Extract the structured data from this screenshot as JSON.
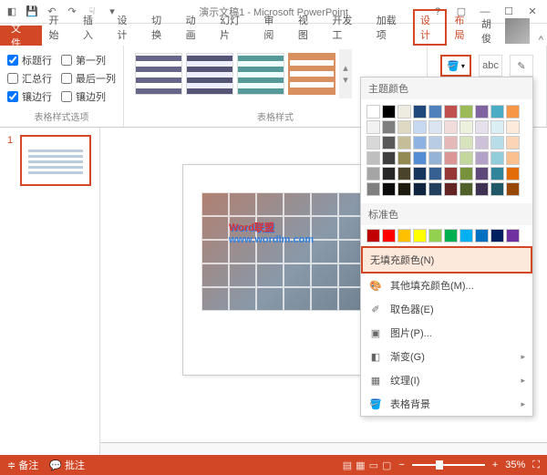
{
  "title": "演示文稿1 - Microsoft PowerPoint",
  "tabs": {
    "file": "文件",
    "home": "开始",
    "insert": "插入",
    "design": "设计",
    "transition": "切换",
    "animation": "动画",
    "slideshow": "幻灯片",
    "review": "审阅",
    "view": "视图",
    "developer": "开发工",
    "addins": "加载项",
    "tdesign": "设计",
    "layout": "布局"
  },
  "username": "胡俊",
  "checks": {
    "header_row": "标题行",
    "first_col": "第一列",
    "total_row": "汇总行",
    "last_col": "最后一列",
    "banded_row": "镶边行",
    "banded_col": "镶边列"
  },
  "group_labels": {
    "options": "表格样式选项",
    "styles": "表格样式"
  },
  "dropdown": {
    "theme_colors": "主题颜色",
    "standard_colors": "标准色",
    "no_fill": "无填充颜色(N)",
    "more_colors": "其他填充颜色(M)...",
    "eyedropper": "取色器(E)",
    "picture": "图片(P)...",
    "gradient": "渐变(G)",
    "texture": "纹理(I)",
    "table_bg": "表格背景"
  },
  "watermark": {
    "line1": "Word联盟",
    "line2": "www.wordlm.com"
  },
  "status": {
    "ready": "备注",
    "comments": "批注",
    "zoom": "35%",
    "abc": "abc",
    "pen": "✎"
  },
  "slide_num": "1",
  "theme_palette": [
    [
      "#ffffff",
      "#000000",
      "#eeece1",
      "#1f497d",
      "#4f81bd",
      "#c0504d",
      "#9bbb59",
      "#8064a2",
      "#4bacc6",
      "#f79646"
    ],
    [
      "#f2f2f2",
      "#7f7f7f",
      "#ddd9c3",
      "#c6d9f0",
      "#dbe5f1",
      "#f2dcdb",
      "#ebf1dd",
      "#e5e0ec",
      "#dbeef3",
      "#fdeada"
    ],
    [
      "#d8d8d8",
      "#595959",
      "#c4bd97",
      "#8db3e2",
      "#b8cce4",
      "#e5b9b7",
      "#d7e3bc",
      "#ccc1d9",
      "#b7dde8",
      "#fbd5b5"
    ],
    [
      "#bfbfbf",
      "#3f3f3f",
      "#938953",
      "#548dd4",
      "#95b3d7",
      "#d99694",
      "#c3d69b",
      "#b2a2c7",
      "#92cddc",
      "#fac08f"
    ],
    [
      "#a5a5a5",
      "#262626",
      "#494429",
      "#17365d",
      "#366092",
      "#953734",
      "#76923c",
      "#5f497a",
      "#31859b",
      "#e36c09"
    ],
    [
      "#7f7f7f",
      "#0c0c0c",
      "#1d1b10",
      "#0f243e",
      "#244061",
      "#632423",
      "#4f6128",
      "#3f3151",
      "#205867",
      "#974806"
    ]
  ],
  "standard_palette": [
    "#c00000",
    "#ff0000",
    "#ffc000",
    "#ffff00",
    "#92d050",
    "#00b050",
    "#00b0f0",
    "#0070c0",
    "#002060",
    "#7030a0"
  ]
}
